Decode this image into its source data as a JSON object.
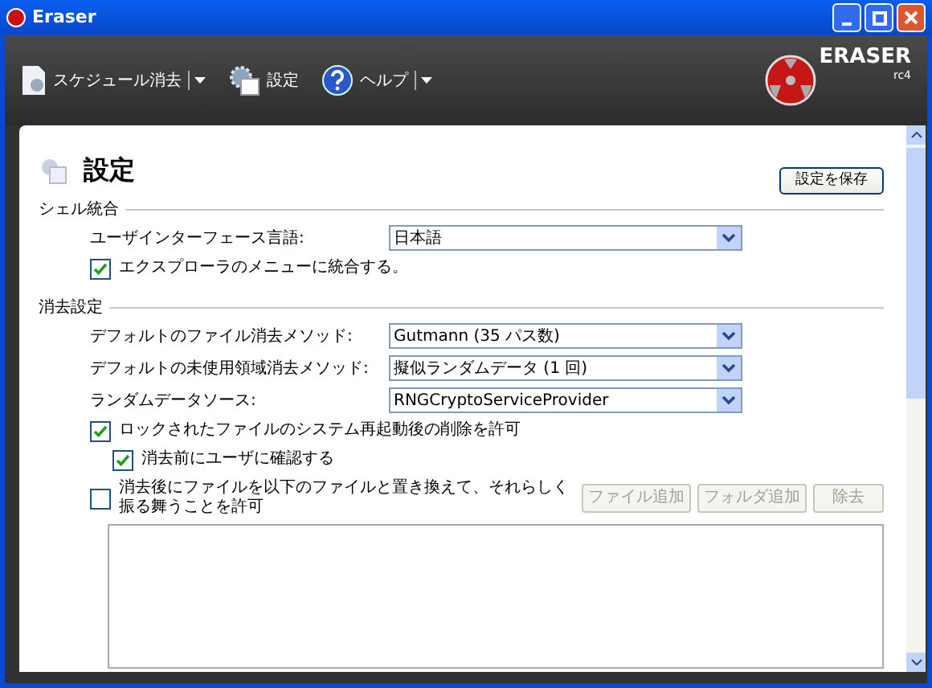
{
  "window": {
    "title": "Eraser"
  },
  "toolbar": {
    "items": [
      {
        "label": "スケジュール消去",
        "kind": "split"
      },
      {
        "label": "設定",
        "kind": "plain"
      },
      {
        "label": "ヘルプ",
        "kind": "split"
      }
    ]
  },
  "logo": {
    "name": "ERASER",
    "version": "rc4"
  },
  "page": {
    "title": "設定",
    "save_button": "設定を保存"
  },
  "sections": [
    {
      "title": "シェル統合",
      "rows": [
        {
          "kind": "dropdown",
          "label": "ユーザインターフェース言語:",
          "value": "日本語"
        },
        {
          "kind": "checkbox",
          "label": "エクスプローラのメニューに統合する。",
          "checked": true
        }
      ]
    },
    {
      "title": "消去設定",
      "rows": [
        {
          "kind": "dropdown",
          "label": "デフォルトのファイル消去メソッド:",
          "value": "Gutmann (35 パス数)"
        },
        {
          "kind": "dropdown",
          "label": "デフォルトの未使用領域消去メソッド:",
          "value": "擬似ランダムデータ (1 回)"
        },
        {
          "kind": "dropdown",
          "label": "ランダムデータソース:",
          "value": "RNGCryptoServiceProvider"
        },
        {
          "kind": "checkbox",
          "label": "ロックされたファイルのシステム再起動後の削除を許可",
          "checked": true,
          "children": [
            {
              "kind": "checkbox",
              "label": "消去前にユーザに確認する",
              "checked": true
            }
          ]
        },
        {
          "kind": "checkbox",
          "label": "消去後にファイルを以下のファイルと置き換えて、それらしく振る舞うことを許可",
          "checked": false,
          "buttons": [
            {
              "label": "ファイル追加",
              "disabled": true
            },
            {
              "label": "フォルダ追加",
              "disabled": true
            },
            {
              "label": "除去",
              "disabled": true
            }
          ]
        },
        {
          "kind": "listbox"
        }
      ]
    }
  ]
}
